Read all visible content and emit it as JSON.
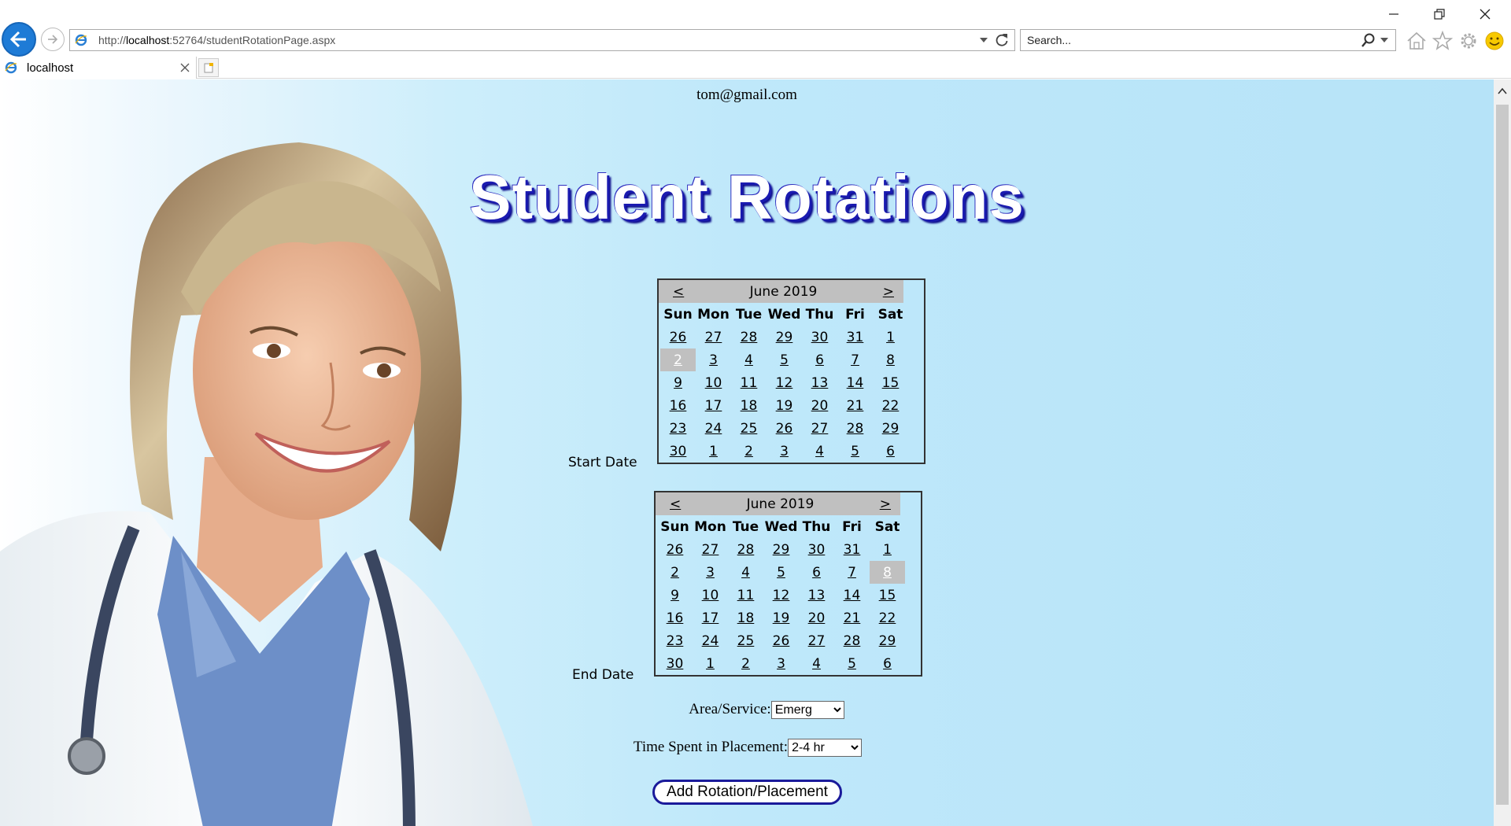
{
  "browser": {
    "url_prefix": "http://",
    "url_host": "localhost",
    "url_rest": ":52764/studentRotationPage.aspx",
    "search_placeholder": "Search...",
    "tab_title": "localhost"
  },
  "page": {
    "user_email": "tom@gmail.com",
    "title": "Student Rotations"
  },
  "start_calendar": {
    "label": "Start Date",
    "prev": "<",
    "next": ">",
    "month": "June 2019",
    "days_of_week": [
      "Sun",
      "Mon",
      "Tue",
      "Wed",
      "Thu",
      "Fri",
      "Sat"
    ],
    "weeks": [
      [
        "26",
        "27",
        "28",
        "29",
        "30",
        "31",
        "1"
      ],
      [
        "2",
        "3",
        "4",
        "5",
        "6",
        "7",
        "8"
      ],
      [
        "9",
        "10",
        "11",
        "12",
        "13",
        "14",
        "15"
      ],
      [
        "16",
        "17",
        "18",
        "19",
        "20",
        "21",
        "22"
      ],
      [
        "23",
        "24",
        "25",
        "26",
        "27",
        "28",
        "29"
      ],
      [
        "30",
        "1",
        "2",
        "3",
        "4",
        "5",
        "6"
      ]
    ],
    "selected": "2"
  },
  "end_calendar": {
    "label": "End Date",
    "prev": "<",
    "next": ">",
    "month": "June 2019",
    "days_of_week": [
      "Sun",
      "Mon",
      "Tue",
      "Wed",
      "Thu",
      "Fri",
      "Sat"
    ],
    "weeks": [
      [
        "26",
        "27",
        "28",
        "29",
        "30",
        "31",
        "1"
      ],
      [
        "2",
        "3",
        "4",
        "5",
        "6",
        "7",
        "8"
      ],
      [
        "9",
        "10",
        "11",
        "12",
        "13",
        "14",
        "15"
      ],
      [
        "16",
        "17",
        "18",
        "19",
        "20",
        "21",
        "22"
      ],
      [
        "23",
        "24",
        "25",
        "26",
        "27",
        "28",
        "29"
      ],
      [
        "30",
        "1",
        "2",
        "3",
        "4",
        "5",
        "6"
      ]
    ],
    "selected": "8"
  },
  "form": {
    "area_label": "Area/Service:",
    "area_value": "Emerg",
    "time_label": "Time Spent in Placement:",
    "time_value": "2-4 hr",
    "submit_label": "Add Rotation/Placement"
  },
  "colors": {
    "calendar_header": "#c0c0c0",
    "selected_day": "#c0c0c0",
    "title_shadow": "#1a1ab0",
    "button_border": "#1a1a9a"
  }
}
